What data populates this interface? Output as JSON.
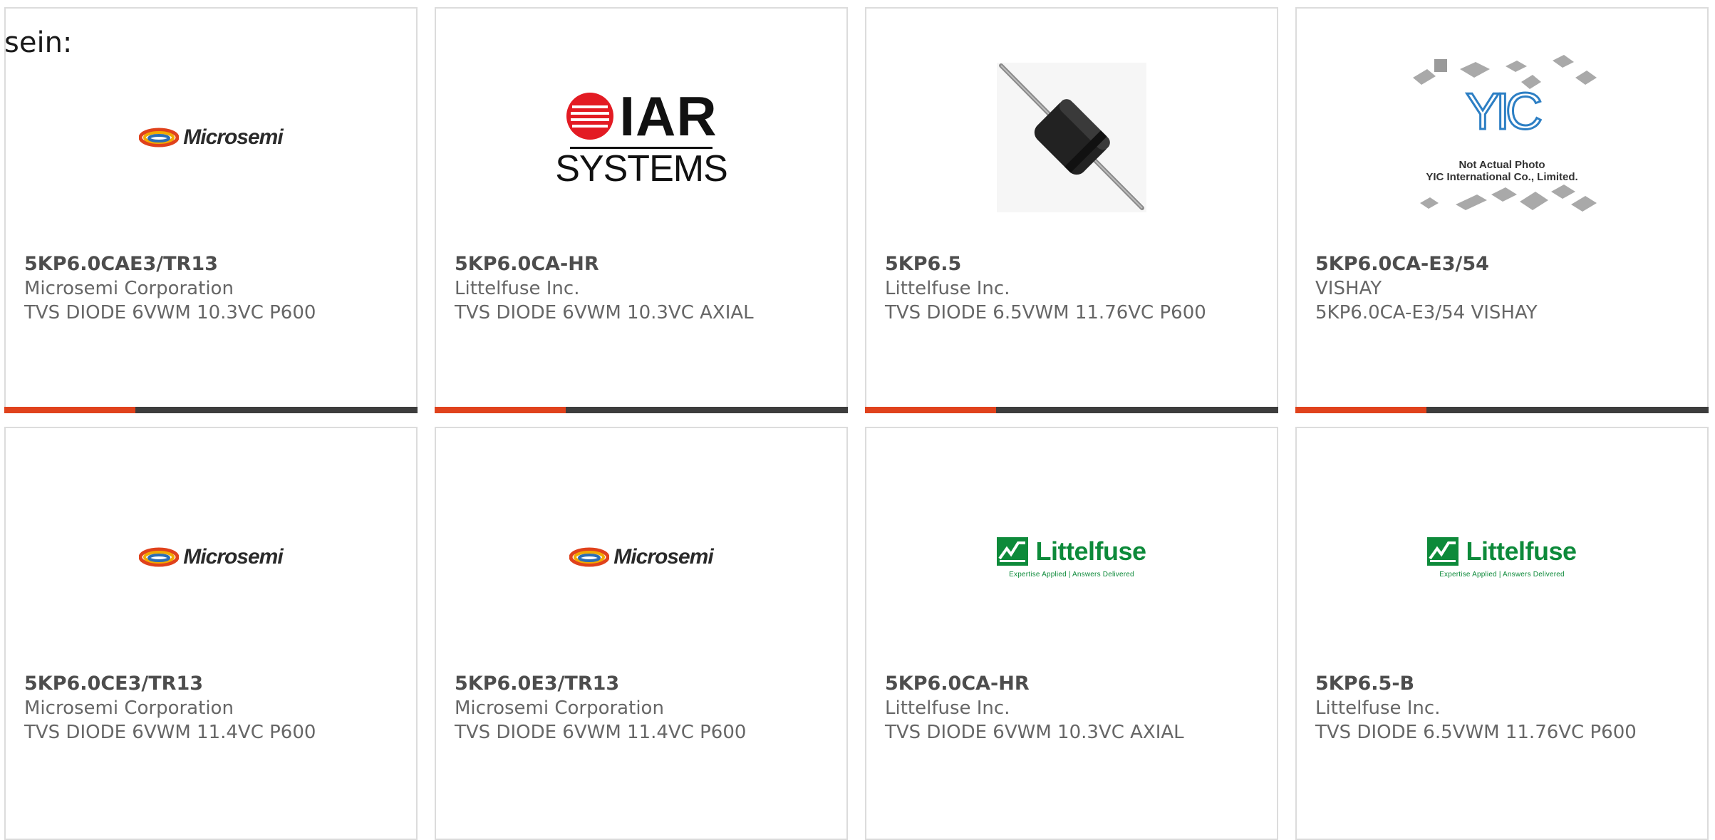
{
  "intro_text": "sein:",
  "colors": {
    "accent": "#e0421c",
    "bar": "#3d3d3d",
    "border": "#dcdcdc",
    "littelfuse_green": "#0d8a3a",
    "yic_blue": "#2d7fc4"
  },
  "products": [
    {
      "part": "5KP6.0CAE3/TR13",
      "manufacturer": "Microsemi Corporation",
      "description": "TVS DIODE 6VWM 10.3VC P600",
      "logo": {
        "type": "microsemi",
        "word": "Microsemi"
      }
    },
    {
      "part": "5KP6.0CA-HR",
      "manufacturer": "Littelfuse Inc.",
      "description": "TVS DIODE 6VWM 10.3VC AXIAL",
      "logo": {
        "type": "iar",
        "word_top": "IAR",
        "word_bottom": "SYSTEMS"
      }
    },
    {
      "part": "5KP6.5",
      "manufacturer": "Littelfuse Inc.",
      "description": "TVS DIODE 6.5VWM 11.76VC P600",
      "logo": {
        "type": "diode-photo"
      }
    },
    {
      "part": "5KP6.0CA-E3/54",
      "manufacturer": "VISHAY",
      "description": "5KP6.0CA-E3/54 VISHAY",
      "logo": {
        "type": "yic",
        "word": "YIC",
        "line1": "Not Actual Photo",
        "line2": "YIC International Co., Limited."
      }
    },
    {
      "part": "5KP6.0CE3/TR13",
      "manufacturer": "Microsemi Corporation",
      "description": "TVS DIODE 6VWM 11.4VC P600",
      "logo": {
        "type": "microsemi",
        "word": "Microsemi"
      }
    },
    {
      "part": "5KP6.0E3/TR13",
      "manufacturer": "Microsemi Corporation",
      "description": "TVS DIODE 6VWM 11.4VC P600",
      "logo": {
        "type": "microsemi",
        "word": "Microsemi"
      }
    },
    {
      "part": "5KP6.0CA-HR",
      "manufacturer": "Littelfuse Inc.",
      "description": "TVS DIODE 6VWM 10.3VC AXIAL",
      "logo": {
        "type": "littelfuse",
        "word": "Littelfuse",
        "tagline": "Expertise Applied | Answers Delivered"
      }
    },
    {
      "part": "5KP6.5-B",
      "manufacturer": "Littelfuse Inc.",
      "description": "TVS DIODE 6.5VWM 11.76VC P600",
      "logo": {
        "type": "littelfuse",
        "word": "Littelfuse",
        "tagline": "Expertise Applied | Answers Delivered"
      }
    }
  ]
}
